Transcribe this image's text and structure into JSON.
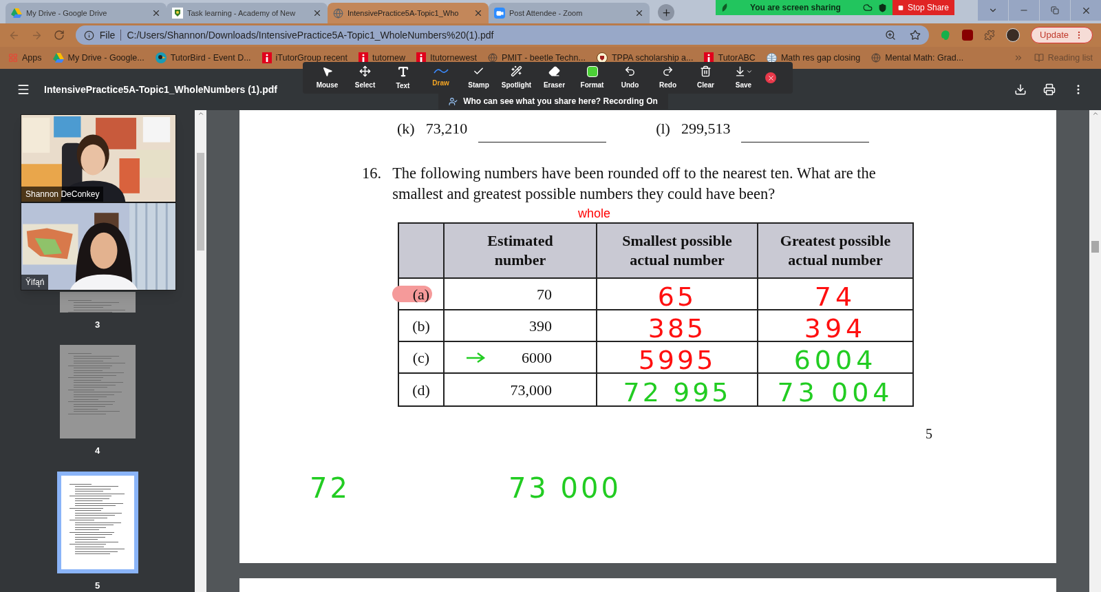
{
  "browser": {
    "tabs": [
      {
        "title": "My Drive - Google Drive",
        "selected": false
      },
      {
        "title": "Task learning - Academy of New",
        "selected": false
      },
      {
        "title": "IntensivePractice5A-Topic1_Who",
        "selected": true
      },
      {
        "title": "Post Attendee - Zoom",
        "selected": false
      }
    ],
    "address": {
      "scheme": "File",
      "url": "C:/Users/Shannon/Downloads/IntensivePractice5A-Topic1_WholeNumbers%20(1).pdf"
    },
    "update": "Update",
    "bookmarks": [
      {
        "label": "Apps"
      },
      {
        "label": "My Drive - Google..."
      },
      {
        "label": "TutorBird - Event D..."
      },
      {
        "label": "iTutorGroup recent"
      },
      {
        "label": "tutornew"
      },
      {
        "label": "Itutornewest"
      },
      {
        "label": "PMIT - beetle Techn..."
      },
      {
        "label": "TPPA scholarship a..."
      },
      {
        "label": "TutorABC"
      },
      {
        "label": "Math res gap closing"
      },
      {
        "label": "Mental Math: Grad..."
      }
    ],
    "reading_list": "Reading list"
  },
  "share_bar": {
    "status": "You are screen sharing",
    "stop": "Stop Share"
  },
  "pdf_viewer": {
    "title": "IntensivePractice5A-Topic1_WholeNumbers (1).pdf"
  },
  "annotation_toolbar": {
    "tools": [
      {
        "label": "Mouse",
        "selected": false
      },
      {
        "label": "Select",
        "selected": false
      },
      {
        "label": "Text",
        "selected": false
      },
      {
        "label": "Draw",
        "selected": true
      },
      {
        "label": "Stamp",
        "selected": false
      },
      {
        "label": "Spotlight",
        "selected": false
      },
      {
        "label": "Eraser",
        "selected": false
      },
      {
        "label": "Format",
        "selected": false
      },
      {
        "label": "Undo",
        "selected": false
      },
      {
        "label": "Redo",
        "selected": false
      },
      {
        "label": "Clear",
        "selected": false
      },
      {
        "label": "Save",
        "selected": false
      }
    ],
    "notice": "Who can see what you share here? Recording On"
  },
  "video_tiles": [
    {
      "name": "Shannon DeConkey"
    },
    {
      "name": "Ÿifąń"
    }
  ],
  "thumbnails": [
    {
      "page": "3",
      "selected": false
    },
    {
      "page": "4",
      "selected": false
    },
    {
      "page": "5",
      "selected": true
    }
  ],
  "page": {
    "previous_items": [
      {
        "label": "(k)",
        "value": "73,210"
      },
      {
        "label": "(l)",
        "value": "299,513"
      }
    ],
    "question": {
      "number": "16.",
      "text": "The following numbers have been rounded off to the nearest ten. What are the smallest and greatest possible numbers they could have been?"
    },
    "note": {
      "text": "whole",
      "color": "#ff0000"
    },
    "table": {
      "columns": [
        "Estimated number",
        "Smallest possible actual number",
        "Greatest possible actual number"
      ],
      "rows": [
        {
          "label": "(a)",
          "highlighted": true,
          "arrow": false,
          "estimate": "70",
          "smallest": {
            "text": "65",
            "color": "#ff1010"
          },
          "greatest": {
            "text": "74",
            "color": "#ff1010"
          }
        },
        {
          "label": "(b)",
          "highlighted": false,
          "arrow": false,
          "estimate": "390",
          "smallest": {
            "text": "385",
            "color": "#ff1010"
          },
          "greatest": {
            "text": "394",
            "color": "#ff1010"
          }
        },
        {
          "label": "(c)",
          "highlighted": false,
          "arrow": true,
          "estimate": "6000",
          "smallest": {
            "text": "5995",
            "color": "#ff1010"
          },
          "greatest": {
            "text": "6004",
            "color": "#22cc22"
          }
        },
        {
          "label": "(d)",
          "highlighted": false,
          "arrow": false,
          "estimate": "73,000",
          "smallest": {
            "text": "72 995",
            "color": "#22cc22"
          },
          "greatest": {
            "text": "73 004",
            "color": "#22cc22"
          }
        }
      ]
    },
    "page_number": "5",
    "scribbles": [
      {
        "text": "72",
        "color": "#22cc22"
      },
      {
        "text": "73 000",
        "color": "#22cc22"
      }
    ]
  }
}
